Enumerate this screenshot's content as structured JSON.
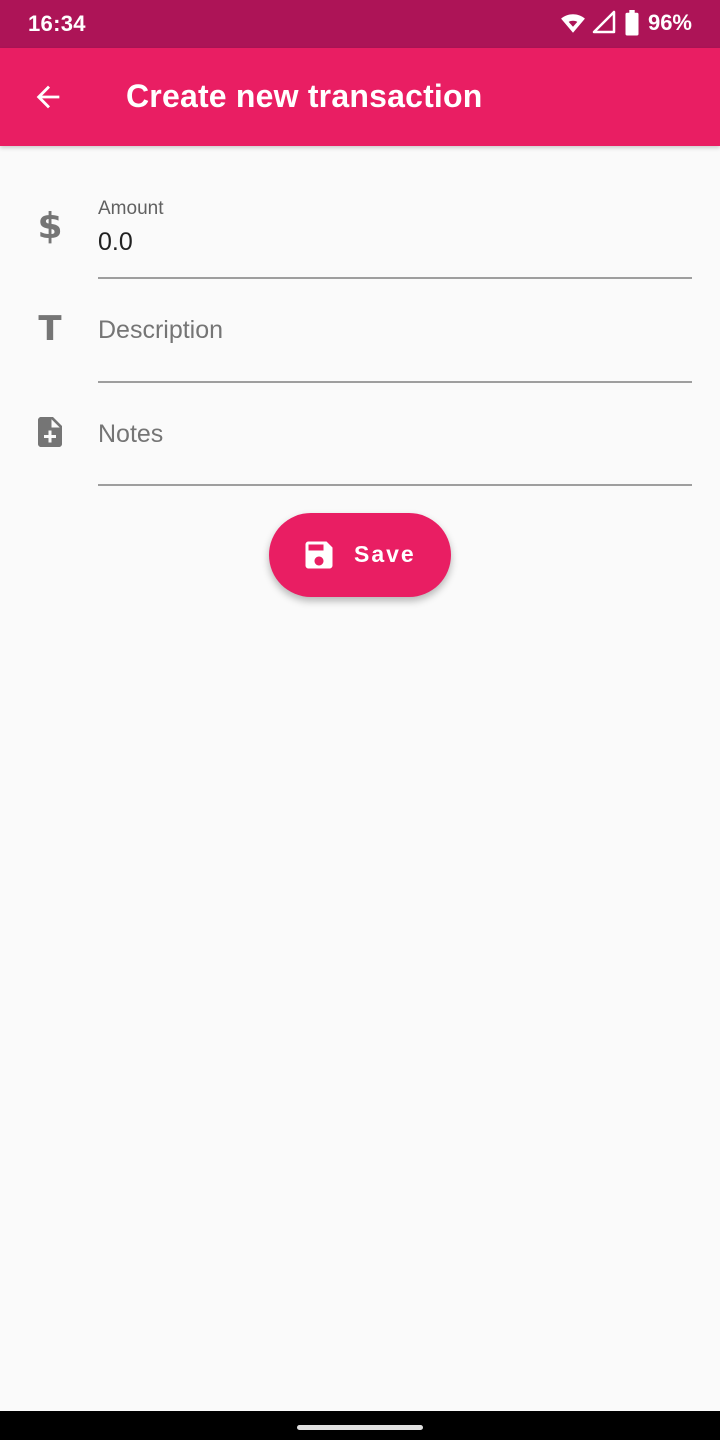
{
  "status_bar": {
    "time": "16:34",
    "battery": "96%",
    "icons": [
      "wifi-icon",
      "signal-icon",
      "battery-icon"
    ]
  },
  "app_bar": {
    "title": "Create new transaction",
    "back_icon": "arrow-back-icon"
  },
  "form": {
    "amount": {
      "label": "Amount",
      "value": "0.0",
      "icon": "dollar-icon"
    },
    "description": {
      "placeholder": "Description",
      "icon": "text-icon"
    },
    "notes": {
      "placeholder": "Notes",
      "icon": "note-add-icon"
    }
  },
  "save_button": {
    "label": "Save",
    "icon": "save-icon"
  },
  "colors": {
    "primary": "#e91e63",
    "primary_dark": "#ad1457",
    "background": "#fafafa",
    "icon_grey": "#757575"
  }
}
